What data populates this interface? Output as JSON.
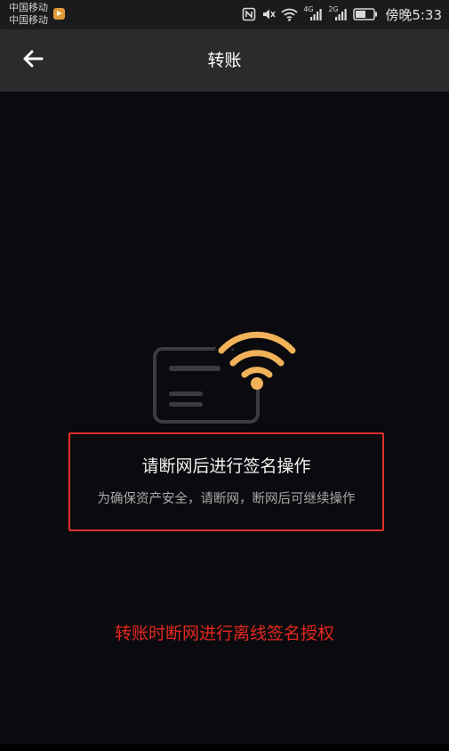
{
  "status_bar": {
    "carrier_1": "中国移动",
    "carrier_2": "中国移动",
    "time": "傍晚5:33",
    "icons": [
      "app-notification-icon",
      "nfc-icon",
      "mute-icon",
      "wifi-icon",
      "signal-4g-icon",
      "signal-2g-icon",
      "battery-icon"
    ],
    "network_1": "4G",
    "network_2": "2G"
  },
  "app_bar": {
    "title": "转账",
    "back_icon": "arrow-left-icon"
  },
  "illustration": {
    "icons": [
      "card-icon",
      "wifi-icon"
    ],
    "accent_color": "#f2b25a",
    "outline_color": "#3c3c40"
  },
  "message": {
    "title": "请断网后进行签名操作",
    "description": "为确保资产安全，请断网，断网后可继续操作",
    "border_color": "#e0302a"
  },
  "annotation": {
    "text": "转账时断网进行离线签名授权",
    "color": "#e5281f"
  }
}
